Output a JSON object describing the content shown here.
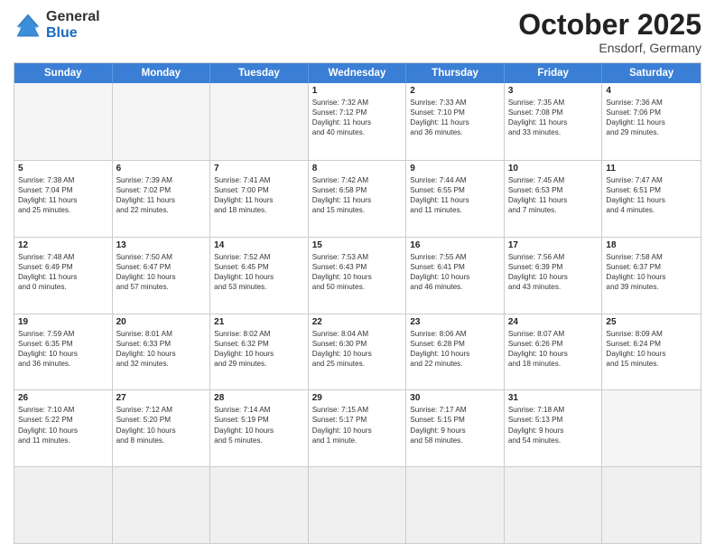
{
  "logo": {
    "general": "General",
    "blue": "Blue"
  },
  "title": {
    "month": "October 2025",
    "location": "Ensdorf, Germany"
  },
  "calendar": {
    "headers": [
      "Sunday",
      "Monday",
      "Tuesday",
      "Wednesday",
      "Thursday",
      "Friday",
      "Saturday"
    ],
    "rows": [
      [
        {
          "day": "",
          "lines": [],
          "empty": true
        },
        {
          "day": "",
          "lines": [],
          "empty": true
        },
        {
          "day": "",
          "lines": [],
          "empty": true
        },
        {
          "day": "1",
          "lines": [
            "Sunrise: 7:32 AM",
            "Sunset: 7:12 PM",
            "Daylight: 11 hours",
            "and 40 minutes."
          ]
        },
        {
          "day": "2",
          "lines": [
            "Sunrise: 7:33 AM",
            "Sunset: 7:10 PM",
            "Daylight: 11 hours",
            "and 36 minutes."
          ]
        },
        {
          "day": "3",
          "lines": [
            "Sunrise: 7:35 AM",
            "Sunset: 7:08 PM",
            "Daylight: 11 hours",
            "and 33 minutes."
          ]
        },
        {
          "day": "4",
          "lines": [
            "Sunrise: 7:36 AM",
            "Sunset: 7:06 PM",
            "Daylight: 11 hours",
            "and 29 minutes."
          ]
        }
      ],
      [
        {
          "day": "5",
          "lines": [
            "Sunrise: 7:38 AM",
            "Sunset: 7:04 PM",
            "Daylight: 11 hours",
            "and 25 minutes."
          ]
        },
        {
          "day": "6",
          "lines": [
            "Sunrise: 7:39 AM",
            "Sunset: 7:02 PM",
            "Daylight: 11 hours",
            "and 22 minutes."
          ]
        },
        {
          "day": "7",
          "lines": [
            "Sunrise: 7:41 AM",
            "Sunset: 7:00 PM",
            "Daylight: 11 hours",
            "and 18 minutes."
          ]
        },
        {
          "day": "8",
          "lines": [
            "Sunrise: 7:42 AM",
            "Sunset: 6:58 PM",
            "Daylight: 11 hours",
            "and 15 minutes."
          ]
        },
        {
          "day": "9",
          "lines": [
            "Sunrise: 7:44 AM",
            "Sunset: 6:55 PM",
            "Daylight: 11 hours",
            "and 11 minutes."
          ]
        },
        {
          "day": "10",
          "lines": [
            "Sunrise: 7:45 AM",
            "Sunset: 6:53 PM",
            "Daylight: 11 hours",
            "and 7 minutes."
          ]
        },
        {
          "day": "11",
          "lines": [
            "Sunrise: 7:47 AM",
            "Sunset: 6:51 PM",
            "Daylight: 11 hours",
            "and 4 minutes."
          ]
        }
      ],
      [
        {
          "day": "12",
          "lines": [
            "Sunrise: 7:48 AM",
            "Sunset: 6:49 PM",
            "Daylight: 11 hours",
            "and 0 minutes."
          ]
        },
        {
          "day": "13",
          "lines": [
            "Sunrise: 7:50 AM",
            "Sunset: 6:47 PM",
            "Daylight: 10 hours",
            "and 57 minutes."
          ]
        },
        {
          "day": "14",
          "lines": [
            "Sunrise: 7:52 AM",
            "Sunset: 6:45 PM",
            "Daylight: 10 hours",
            "and 53 minutes."
          ]
        },
        {
          "day": "15",
          "lines": [
            "Sunrise: 7:53 AM",
            "Sunset: 6:43 PM",
            "Daylight: 10 hours",
            "and 50 minutes."
          ]
        },
        {
          "day": "16",
          "lines": [
            "Sunrise: 7:55 AM",
            "Sunset: 6:41 PM",
            "Daylight: 10 hours",
            "and 46 minutes."
          ]
        },
        {
          "day": "17",
          "lines": [
            "Sunrise: 7:56 AM",
            "Sunset: 6:39 PM",
            "Daylight: 10 hours",
            "and 43 minutes."
          ]
        },
        {
          "day": "18",
          "lines": [
            "Sunrise: 7:58 AM",
            "Sunset: 6:37 PM",
            "Daylight: 10 hours",
            "and 39 minutes."
          ]
        }
      ],
      [
        {
          "day": "19",
          "lines": [
            "Sunrise: 7:59 AM",
            "Sunset: 6:35 PM",
            "Daylight: 10 hours",
            "and 36 minutes."
          ]
        },
        {
          "day": "20",
          "lines": [
            "Sunrise: 8:01 AM",
            "Sunset: 6:33 PM",
            "Daylight: 10 hours",
            "and 32 minutes."
          ]
        },
        {
          "day": "21",
          "lines": [
            "Sunrise: 8:02 AM",
            "Sunset: 6:32 PM",
            "Daylight: 10 hours",
            "and 29 minutes."
          ]
        },
        {
          "day": "22",
          "lines": [
            "Sunrise: 8:04 AM",
            "Sunset: 6:30 PM",
            "Daylight: 10 hours",
            "and 25 minutes."
          ]
        },
        {
          "day": "23",
          "lines": [
            "Sunrise: 8:06 AM",
            "Sunset: 6:28 PM",
            "Daylight: 10 hours",
            "and 22 minutes."
          ]
        },
        {
          "day": "24",
          "lines": [
            "Sunrise: 8:07 AM",
            "Sunset: 6:26 PM",
            "Daylight: 10 hours",
            "and 18 minutes."
          ]
        },
        {
          "day": "25",
          "lines": [
            "Sunrise: 8:09 AM",
            "Sunset: 6:24 PM",
            "Daylight: 10 hours",
            "and 15 minutes."
          ]
        }
      ],
      [
        {
          "day": "26",
          "lines": [
            "Sunrise: 7:10 AM",
            "Sunset: 5:22 PM",
            "Daylight: 10 hours",
            "and 11 minutes."
          ]
        },
        {
          "day": "27",
          "lines": [
            "Sunrise: 7:12 AM",
            "Sunset: 5:20 PM",
            "Daylight: 10 hours",
            "and 8 minutes."
          ]
        },
        {
          "day": "28",
          "lines": [
            "Sunrise: 7:14 AM",
            "Sunset: 5:19 PM",
            "Daylight: 10 hours",
            "and 5 minutes."
          ]
        },
        {
          "day": "29",
          "lines": [
            "Sunrise: 7:15 AM",
            "Sunset: 5:17 PM",
            "Daylight: 10 hours",
            "and 1 minute."
          ]
        },
        {
          "day": "30",
          "lines": [
            "Sunrise: 7:17 AM",
            "Sunset: 5:15 PM",
            "Daylight: 9 hours",
            "and 58 minutes."
          ]
        },
        {
          "day": "31",
          "lines": [
            "Sunrise: 7:18 AM",
            "Sunset: 5:13 PM",
            "Daylight: 9 hours",
            "and 54 minutes."
          ]
        },
        {
          "day": "",
          "lines": [],
          "empty": true
        }
      ],
      [
        {
          "day": "",
          "lines": [],
          "empty": true,
          "shaded": true
        },
        {
          "day": "",
          "lines": [],
          "empty": true,
          "shaded": true
        },
        {
          "day": "",
          "lines": [],
          "empty": true,
          "shaded": true
        },
        {
          "day": "",
          "lines": [],
          "empty": true,
          "shaded": true
        },
        {
          "day": "",
          "lines": [],
          "empty": true,
          "shaded": true
        },
        {
          "day": "",
          "lines": [],
          "empty": true,
          "shaded": true
        },
        {
          "day": "",
          "lines": [],
          "empty": true,
          "shaded": true
        }
      ]
    ]
  }
}
